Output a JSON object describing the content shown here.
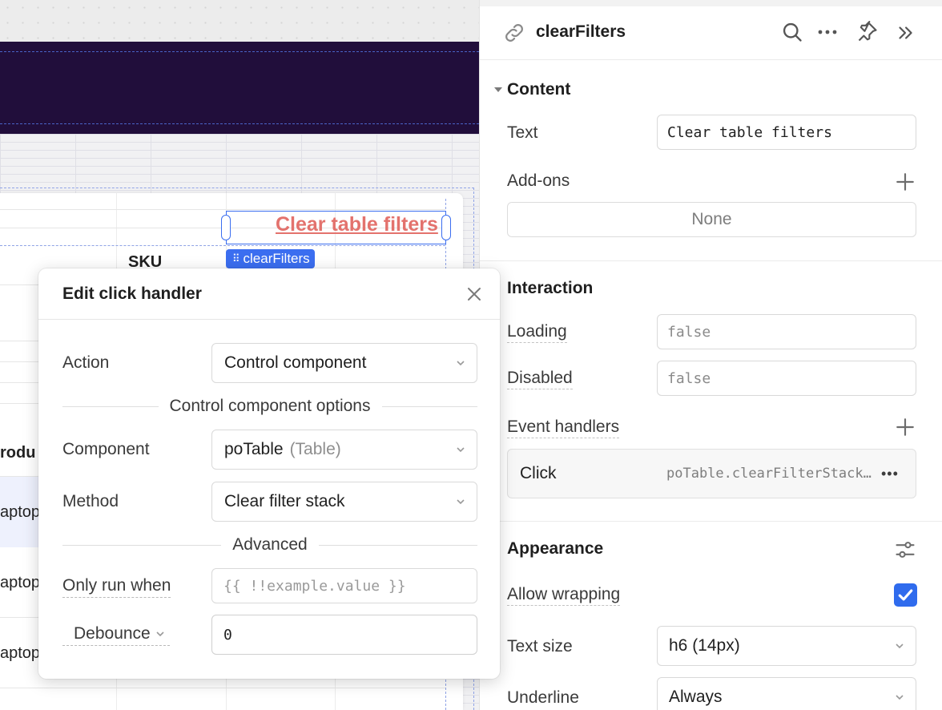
{
  "canvas": {
    "button_text": "Clear table filters",
    "selected_component_tag": "clearFilters",
    "table_header_sku": "SKU",
    "table_header_product_fragment": "rodu",
    "row_fragments": [
      "aptop",
      "aptop",
      "aptop"
    ]
  },
  "modal": {
    "title": "Edit click handler",
    "action_label": "Action",
    "action_value": "Control component",
    "options_section": "Control component options",
    "component_label": "Component",
    "component_value": "poTable",
    "component_type": "(Table)",
    "method_label": "Method",
    "method_value": "Clear filter stack",
    "advanced_section": "Advanced",
    "only_run_when_label": "Only run when",
    "only_run_when_placeholder": "{{ !!example.value }}",
    "debounce_label": "Debounce",
    "debounce_value": "0"
  },
  "inspector": {
    "title": "clearFilters",
    "content": {
      "section": "Content",
      "text_label": "Text",
      "text_value": "Clear table filters",
      "addons_label": "Add-ons",
      "addons_value": "None"
    },
    "interaction": {
      "section": "Interaction",
      "loading_label": "Loading",
      "loading_value": "false",
      "disabled_label": "Disabled",
      "disabled_value": "false",
      "event_handlers_label": "Event handlers",
      "handler_event": "Click",
      "handler_code": "poTable.clearFilterStack()"
    },
    "appearance": {
      "section": "Appearance",
      "allow_wrapping_label": "Allow wrapping",
      "allow_wrapping_checked": true,
      "text_size_label": "Text size",
      "text_size_value": "h6 (14px)",
      "underline_label": "Underline",
      "underline_value": "Always"
    }
  },
  "colors": {
    "accent": "#2f6bed",
    "link": "#e3726d",
    "header_band": "#210e3b"
  }
}
